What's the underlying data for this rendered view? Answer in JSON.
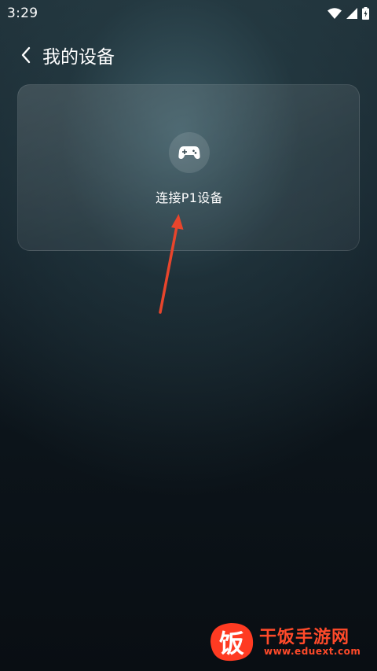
{
  "status_bar": {
    "time": "3:29"
  },
  "header": {
    "title": "我的设备",
    "back_icon": "chevron-left-icon"
  },
  "device_card": {
    "label": "连接P1设备",
    "icon": "gamepad-icon"
  },
  "watermark": {
    "site_name": "干饭手游网",
    "url": "www.eduext.com",
    "logo_char": "饭"
  },
  "colors": {
    "watermark": "#ff4a2a",
    "arrow": "#e8452c"
  }
}
